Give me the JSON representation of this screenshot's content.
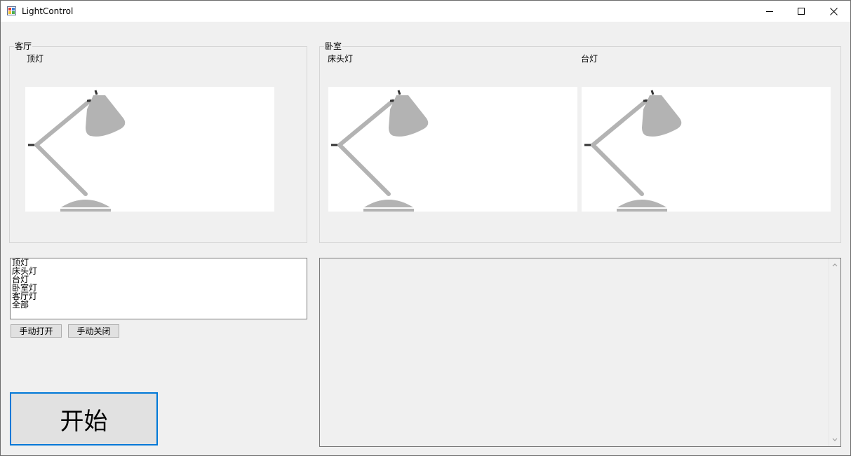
{
  "window": {
    "title": "LightControl",
    "controls": [
      "minimize-icon",
      "maximize-icon",
      "close-icon"
    ]
  },
  "living_room": {
    "title": "客厅",
    "lights": [
      {
        "label": "顶灯",
        "icon": "desk-lamp-icon"
      }
    ]
  },
  "bedroom": {
    "title": "卧室",
    "lights": [
      {
        "label": "床头灯",
        "icon": "desk-lamp-icon"
      },
      {
        "label": "台灯",
        "icon": "desk-lamp-icon"
      }
    ]
  },
  "light_list": {
    "items": [
      "顶灯",
      "床头灯",
      "台灯",
      "卧室灯",
      "客厅灯",
      "全部"
    ]
  },
  "buttons": {
    "manual_on": "手动打开",
    "manual_off": "手动关闭",
    "start": "开始"
  },
  "colors": {
    "accent": "#0078d7",
    "lamp": "#b3b3b3",
    "lamp_dark": "#333333"
  }
}
